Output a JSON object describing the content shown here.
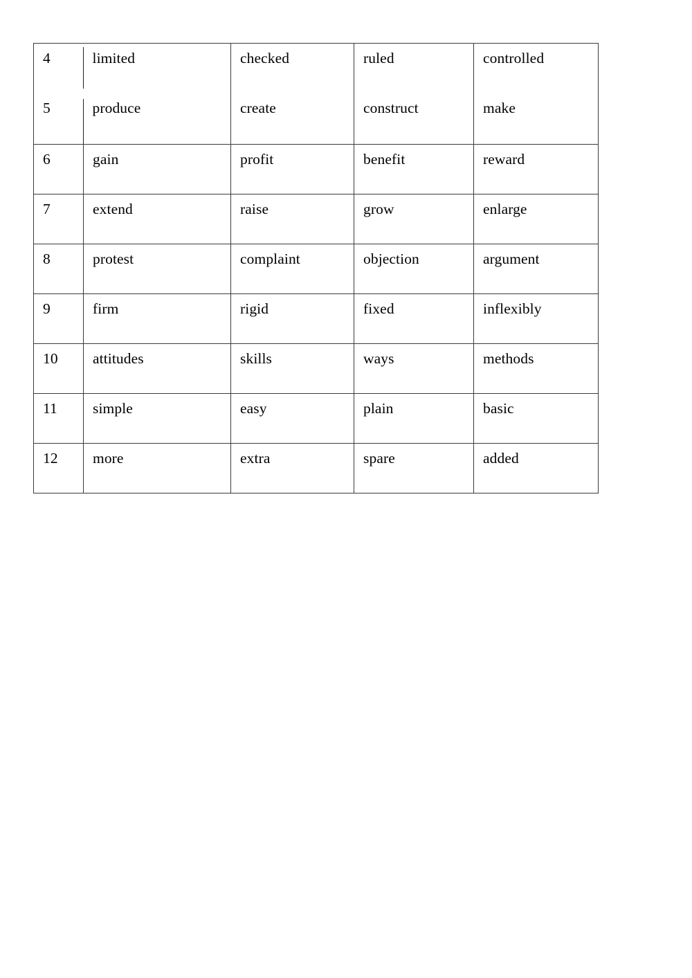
{
  "document": {
    "type": "worksheet-table",
    "background_color": "#ffffff",
    "border_color": "#3a3a3a",
    "text_color": "#000000"
  },
  "table": {
    "name": "synonyms-table",
    "column_count": 5,
    "row_count": 9,
    "merged_band": {
      "note": "rows 4 and 5 share one band with no horizontal divider between them",
      "rows": [
        {
          "number": "4",
          "word": "limited",
          "syn1": "checked",
          "syn2": "ruled",
          "syn3": "controlled"
        },
        {
          "number": "5",
          "word": "produce",
          "syn1": "create",
          "syn2": "construct",
          "syn3": "make"
        }
      ]
    },
    "rows": [
      {
        "number": "6",
        "word": "gain",
        "syn1": "profit",
        "syn2": "benefit",
        "syn3": "reward"
      },
      {
        "number": "7",
        "word": "extend",
        "syn1": "raise",
        "syn2": "grow",
        "syn3": "enlarge"
      },
      {
        "number": "8",
        "word": "protest",
        "syn1": "complaint",
        "syn2": "objection",
        "syn3": "argument"
      },
      {
        "number": "9",
        "word": "firm",
        "syn1": "rigid",
        "syn2": "fixed",
        "syn3": "inflexibly"
      },
      {
        "number": "10",
        "word": "attitudes",
        "syn1": "skills",
        "syn2": "ways",
        "syn3": "methods"
      },
      {
        "number": "11",
        "word": "simple",
        "syn1": "easy",
        "syn2": "plain",
        "syn3": "basic"
      },
      {
        "number": "12",
        "word": "more",
        "syn1": "extra",
        "syn2": "spare",
        "syn3": "added"
      }
    ]
  }
}
